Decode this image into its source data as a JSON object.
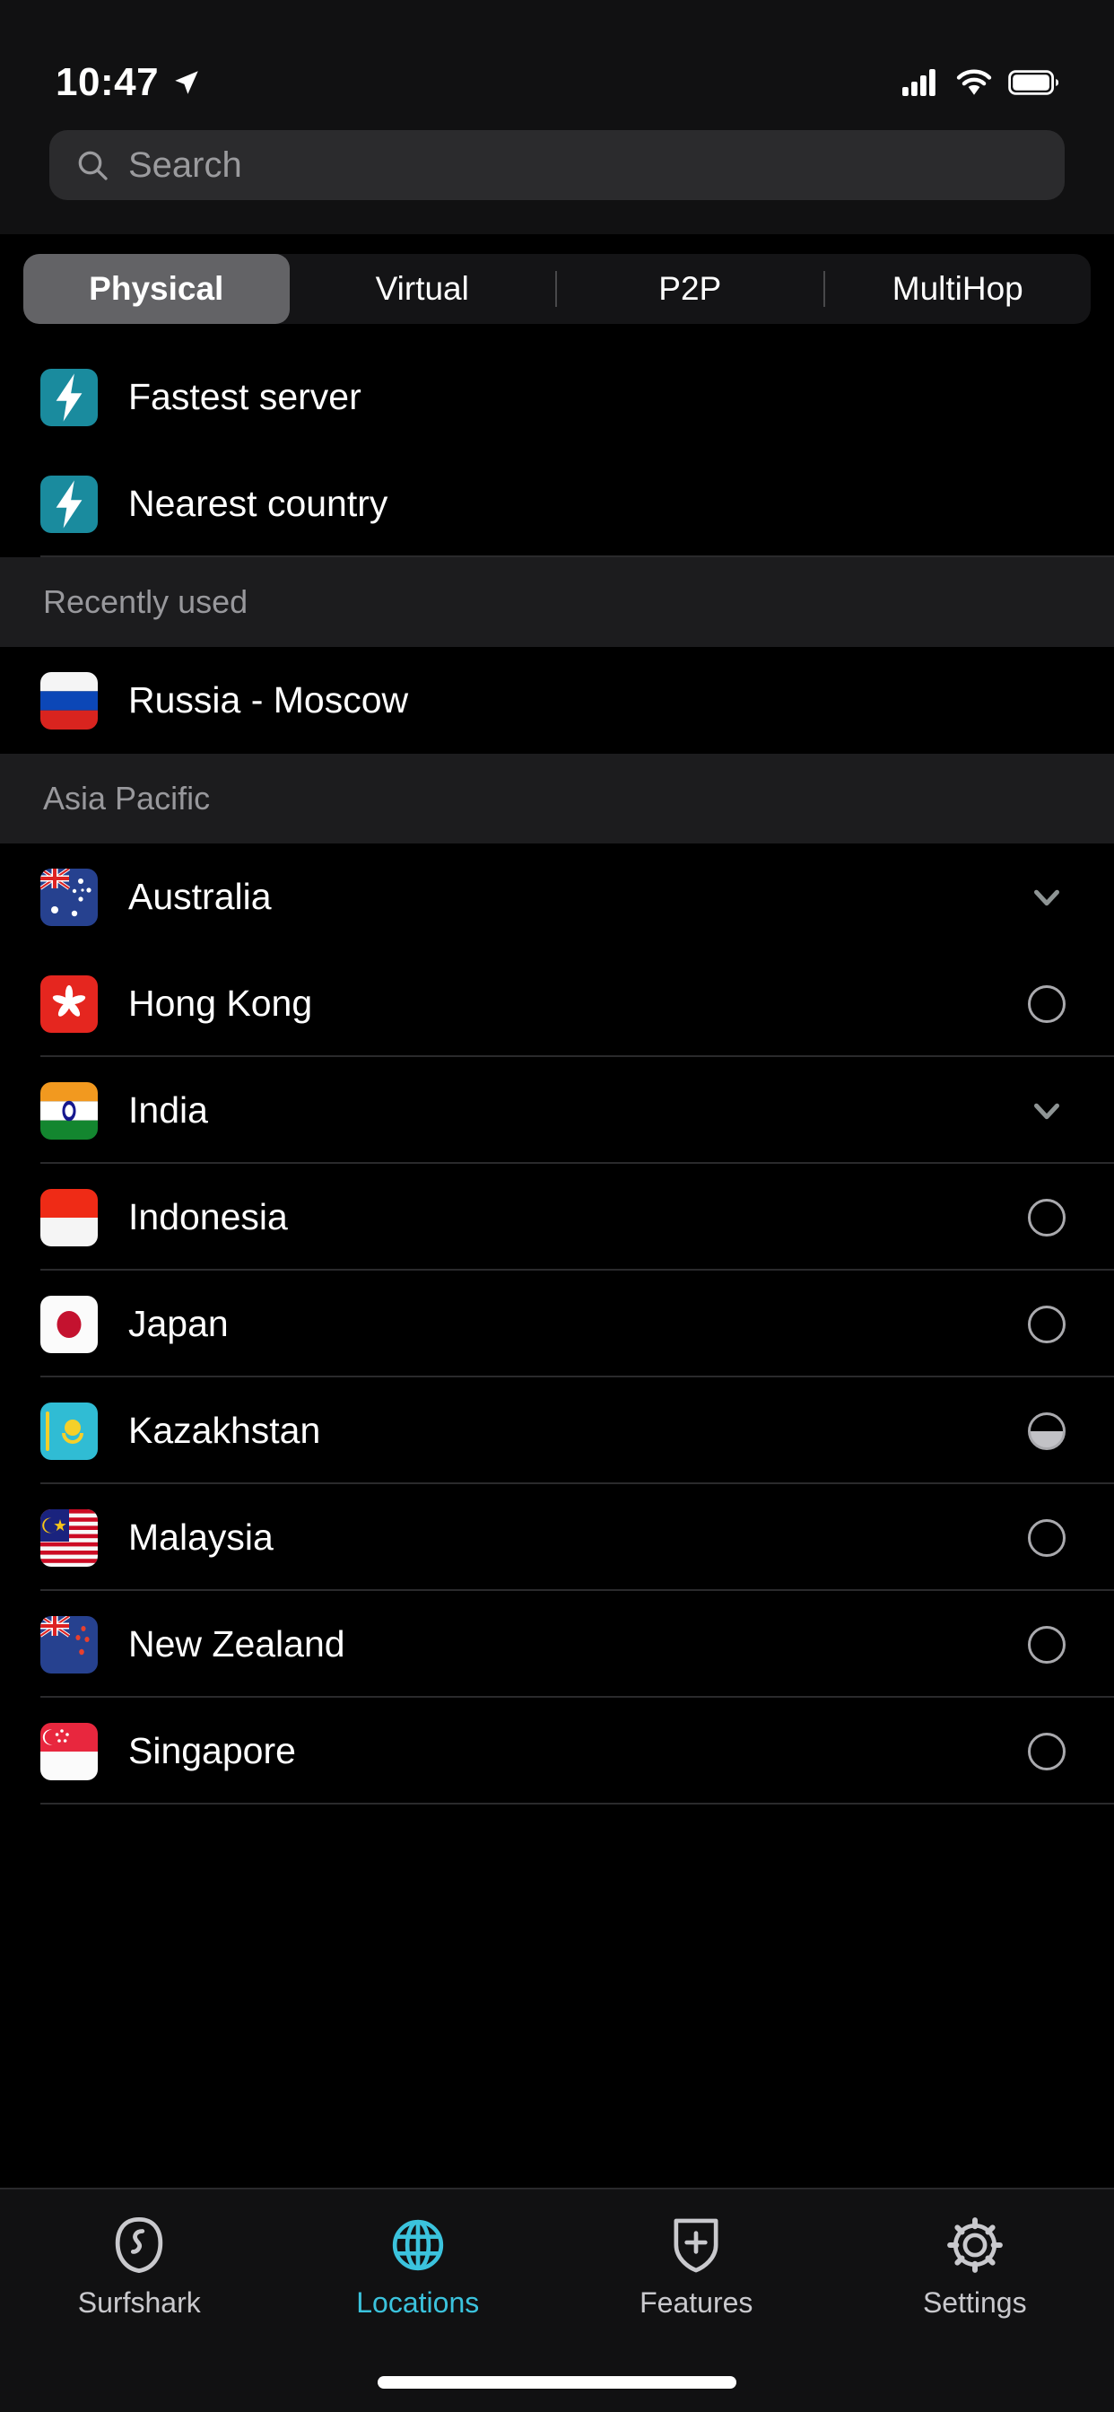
{
  "status_bar": {
    "time": "10:47",
    "location_icon": "location-arrow-icon",
    "signal_icon": "cellular-signal-icon",
    "wifi_icon": "wifi-icon",
    "battery_icon": "battery-full-icon"
  },
  "search": {
    "placeholder": "Search",
    "value": "",
    "icon": "search-icon"
  },
  "segmented_control": {
    "selected": "Physical",
    "items": [
      {
        "label": "Physical",
        "active": true
      },
      {
        "label": "Virtual",
        "active": false
      },
      {
        "label": "P2P",
        "active": false
      },
      {
        "label": "MultiHop",
        "active": false
      }
    ]
  },
  "quick_connect": [
    {
      "label": "Fastest server",
      "icon": "lightning-bolt-icon",
      "icon_color": "#1a8b9e"
    },
    {
      "label": "Nearest country",
      "icon": "lightning-bolt-icon",
      "icon_color": "#1a8b9e"
    }
  ],
  "sections": [
    {
      "header": "Recently used",
      "rows": [
        {
          "label": "Russia - Moscow",
          "flag": "flag-russia",
          "indicator": "none"
        }
      ]
    },
    {
      "header": "Asia Pacific",
      "rows": [
        {
          "label": "Australia",
          "flag": "flag-australia",
          "indicator": "chevron-down"
        },
        {
          "label": "Hong Kong",
          "flag": "flag-hong-kong",
          "indicator": "circle"
        },
        {
          "label": "India",
          "flag": "flag-india",
          "indicator": "chevron-down"
        },
        {
          "label": "Indonesia",
          "flag": "flag-indonesia",
          "indicator": "circle"
        },
        {
          "label": "Japan",
          "flag": "flag-japan",
          "indicator": "circle"
        },
        {
          "label": "Kazakhstan",
          "flag": "flag-kazakhstan",
          "indicator": "circle-half"
        },
        {
          "label": "Malaysia",
          "flag": "flag-malaysia",
          "indicator": "circle"
        },
        {
          "label": "New Zealand",
          "flag": "flag-new-zealand",
          "indicator": "circle"
        },
        {
          "label": "Singapore",
          "flag": "flag-singapore",
          "indicator": "circle"
        }
      ]
    }
  ],
  "tab_bar": {
    "active": "Locations",
    "active_color": "#3bc3dd",
    "inactive_color": "#c9c9cd",
    "items": [
      {
        "label": "Surfshark",
        "icon": "surfshark-logo-icon",
        "active": false
      },
      {
        "label": "Locations",
        "icon": "globe-icon",
        "active": true
      },
      {
        "label": "Features",
        "icon": "shield-plus-icon",
        "active": false
      },
      {
        "label": "Settings",
        "icon": "gear-icon",
        "active": false
      }
    ]
  }
}
